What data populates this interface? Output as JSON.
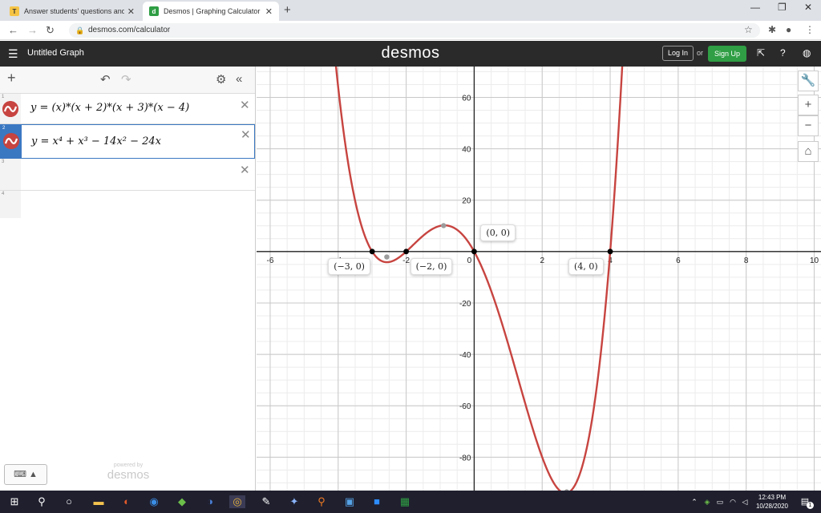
{
  "browser": {
    "tabs": [
      {
        "title": "Answer students' questions and",
        "active": false
      },
      {
        "title": "Desmos | Graphing Calculator",
        "active": true
      }
    ],
    "url": "desmos.com/calculator"
  },
  "header": {
    "graph_title": "Untitled Graph",
    "logo": "desmos",
    "login_label": "Log In",
    "or_label": "or",
    "signup_label": "Sign Up",
    "signup_color": "#2f9e44"
  },
  "expressions": [
    {
      "num": "1",
      "latex": "y = (x)*(x + 2)*(x + 3)*(x − 4)",
      "color": "#c74440"
    },
    {
      "num": "2",
      "latex": "y = x⁴ + x³ − 14x² − 24x",
      "color": "#c74440"
    },
    {
      "num": "3",
      "latex": ""
    },
    {
      "num": "4",
      "latex": ""
    }
  ],
  "panel_footer": {
    "powered_by": "powered by",
    "brand": "desmos"
  },
  "chart_data": {
    "type": "line",
    "title": "",
    "xlabel": "",
    "ylabel": "",
    "xlim": [
      -6.4,
      10.2
    ],
    "ylim": [
      -93,
      72
    ],
    "x_ticks": [
      -6,
      -4,
      -2,
      0,
      2,
      4,
      6,
      8,
      10
    ],
    "y_ticks": [
      -80,
      -60,
      -40,
      -20,
      20,
      40,
      60
    ],
    "x_tick_labels": [
      "-6",
      "-4",
      "-2",
      "0",
      "2",
      "4",
      "6",
      "8",
      "10"
    ],
    "y_tick_labels": [
      "-80",
      "-60",
      "-40",
      "-20",
      "20",
      "40",
      "60"
    ],
    "grid": true,
    "series": [
      {
        "function": "y = x^4 + x^3 - 14x^2 - 24x",
        "color": "#c74440"
      }
    ],
    "points": [
      {
        "x": -3,
        "y": 0,
        "label": "(−3, 0)"
      },
      {
        "x": -2,
        "y": 0,
        "label": "(−2, 0)"
      },
      {
        "x": 0,
        "y": 0,
        "label": "(0, 0)"
      },
      {
        "x": 4,
        "y": 0,
        "label": "(4, 0)"
      }
    ],
    "extrema": [
      {
        "x": -2.57,
        "y": -2.1
      },
      {
        "x": -0.9,
        "y": 10.1
      },
      {
        "x": 2.72,
        "y": -93.5
      }
    ]
  },
  "taskbar": {
    "time": "12:43 PM",
    "date": "10/28/2020",
    "notification_count": "1"
  }
}
